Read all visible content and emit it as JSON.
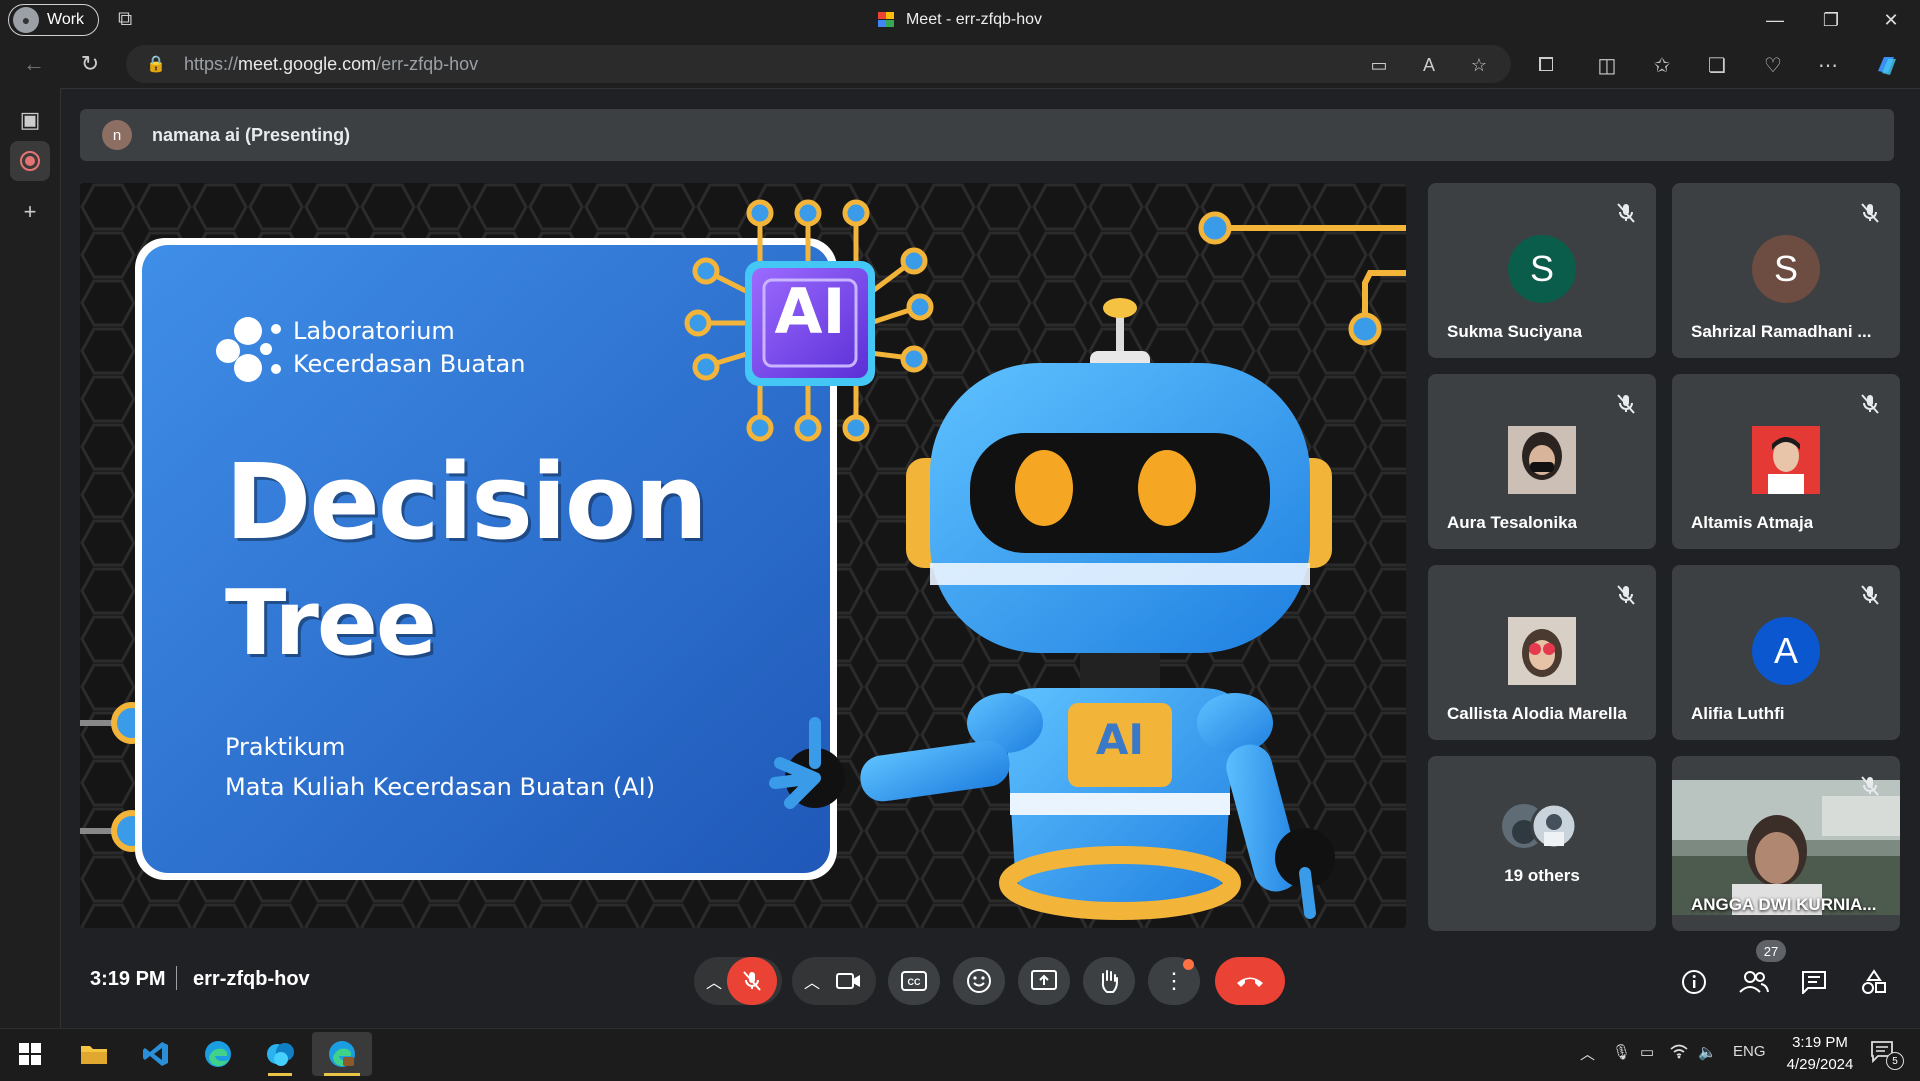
{
  "browser": {
    "profile_label": "Work",
    "window_title": "Meet - err-zfqb-hov",
    "url_prefix": "https://",
    "url_host": "meet.google.com",
    "url_path": "/err-zfqb-hov"
  },
  "presenting": {
    "avatar_letter": "n",
    "label": "namana ai (Presenting)"
  },
  "slide": {
    "lab_line1": "Laboratorium",
    "lab_line2": "Kecerdasan Buatan",
    "title_line1": "Decision",
    "title_line2": "Tree",
    "subtitle_line1": "Praktikum",
    "subtitle_line2": "Mata Kuliah Kecerdasan Buatan (AI)",
    "chip_label": "AI",
    "robot_badge": "AI",
    "brand_color": "#2f7bd9"
  },
  "participants": [
    {
      "name": "Sukma Suciyana",
      "initial": "S",
      "avatar_color": "#0b5d4b",
      "muted": true
    },
    {
      "name": "Sahrizal Ramadhani ...",
      "initial": "S",
      "avatar_color": "#6d4c41",
      "muted": true
    },
    {
      "name": "Aura Tesalonika",
      "initial": "",
      "avatar_color": "photo",
      "muted": true
    },
    {
      "name": "Altamis Atmaja",
      "initial": "",
      "avatar_color": "photo",
      "muted": true
    },
    {
      "name": "Callista Alodia Marella",
      "initial": "",
      "avatar_color": "photo",
      "muted": true
    },
    {
      "name": "Alifia Luthfi",
      "initial": "A",
      "avatar_color": "#0b57d0",
      "muted": true
    },
    {
      "name": "19 others",
      "initial": "",
      "avatar_color": "group",
      "muted": false
    },
    {
      "name": "ANGGA DWI KURNIA...",
      "initial": "",
      "avatar_color": "video",
      "muted": true
    }
  ],
  "meeting": {
    "time": "3:19 PM",
    "code": "err-zfqb-hov",
    "people_count": "27"
  },
  "controls": {
    "mic": "mic-off",
    "camera": "camera",
    "captions": "CC",
    "reactions": "emoji",
    "present": "present-screen",
    "raise_hand": "hand",
    "more": "more-options",
    "leave": "end-call"
  },
  "taskbar": {
    "language": "ENG",
    "clock_time": "3:19 PM",
    "clock_date": "4/29/2024",
    "notification_count": "5"
  }
}
